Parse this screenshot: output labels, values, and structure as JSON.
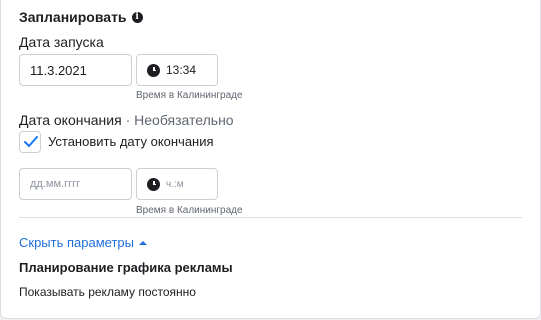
{
  "schedule": {
    "title": "Запланировать",
    "start_label": "Дата запуска",
    "start_date": "11.3.2021",
    "start_time": "13:34",
    "timezone_hint": "Время в Калининграде",
    "end_label": "Дата окончания",
    "end_separator": " · ",
    "end_optional": "Необязательно",
    "set_end_label": "Установить дату окончания",
    "set_end_checked": true,
    "end_date_placeholder": "дд.мм.гггг",
    "end_time_placeholder": "ч.:м",
    "end_timezone_hint": "Время в Калининграде",
    "hide_params_link": "Скрыть параметры",
    "ad_schedule_title": "Планирование графика рекламы",
    "ad_schedule_value": "Показывать рекламу постоянно"
  },
  "colors": {
    "link": "#216fdb",
    "check": "#1877f2"
  },
  "icons": [
    "info-icon",
    "clock-icon",
    "checkmark-icon",
    "caret-up-icon"
  ]
}
